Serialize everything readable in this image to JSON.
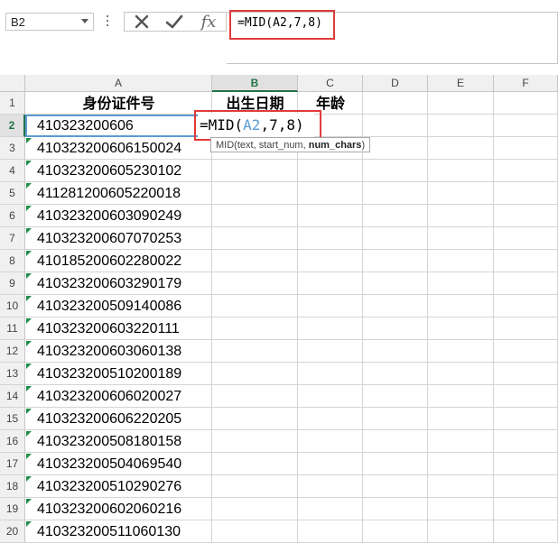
{
  "name_box": {
    "value": "B2"
  },
  "formula_bar": {
    "cancel_glyph": "✕",
    "enter_glyph": "✓",
    "fx_label": "fx",
    "value": "=MID(A2,7,8)"
  },
  "columns": [
    "A",
    "B",
    "C",
    "D",
    "E",
    "F"
  ],
  "selected_column": "B",
  "rows": [
    "1",
    "2",
    "3",
    "4",
    "5",
    "6",
    "7",
    "8",
    "9",
    "10",
    "11",
    "12",
    "13",
    "14",
    "15",
    "16",
    "17",
    "18",
    "19",
    "20"
  ],
  "selected_row": "2",
  "header_row": {
    "A": "身份证件号",
    "B": "出生日期",
    "C": "年龄"
  },
  "id_numbers": [
    "410323200606",
    "410323200606150024",
    "410323200605230102",
    "411281200605220018",
    "410323200603090249",
    "410323200607070253",
    "410185200602280022",
    "410323200603290179",
    "410323200509140086",
    "410323200603220111",
    "410323200603060138",
    "410323200510200189",
    "410323200606020027",
    "410323200606220205",
    "410323200508180158",
    "410323200504069540",
    "410323200510290276",
    "410323200602060216",
    "410323200511060130"
  ],
  "editing_cell": {
    "prefix": "=MID(",
    "ref": "A2",
    "suffix": ",7,8)"
  },
  "tooltip": {
    "fn": "MID(",
    "arg1": "text",
    "sep1": ", ",
    "arg2": "start_num",
    "sep2": ", ",
    "arg3": "num_chars",
    "close": ")"
  },
  "colors": {
    "highlight_box": "#e03a3a",
    "excel_green": "#217346",
    "active_border": "#5b9bd5"
  }
}
